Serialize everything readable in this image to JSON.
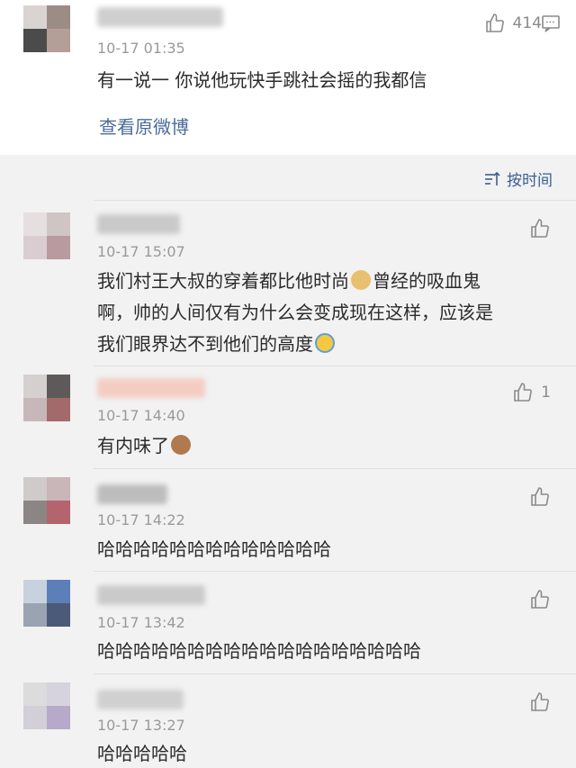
{
  "top_comment": {
    "time": "10-17 01:35",
    "text": "有一说一 你说他玩快手跳社会摇的我都信",
    "likes": "414",
    "view_original": "查看原微博"
  },
  "sort": {
    "label": "按时间"
  },
  "comments": [
    {
      "time": "10-17 15:07",
      "line1": "我们村王大叔的穿着都比他时尚",
      "line1b": "曾经的吸血鬼",
      "line2": "啊，帅的人间仅有为什么会变成现在这样，应该是",
      "line3": "我们眼界达不到他们的高度",
      "likes": ""
    },
    {
      "time": "10-17 14:40",
      "text": "有内味了",
      "likes": "1"
    },
    {
      "time": "10-17 14:22",
      "text": "哈哈哈哈哈哈哈哈哈哈哈哈哈",
      "likes": ""
    },
    {
      "time": "10-17 13:42",
      "text": "哈哈哈哈哈哈哈哈哈哈哈哈哈哈哈哈哈哈",
      "likes": ""
    },
    {
      "time": "10-17 13:27",
      "text": "哈哈哈哈哈",
      "likes": ""
    }
  ],
  "icons": {
    "like": "thumbs-up-icon",
    "comment": "comment-icon",
    "sort": "sort-icon"
  },
  "colors": {
    "link": "#4a6c98",
    "time": "#9a9a9a",
    "background": "#f2f2f2"
  }
}
